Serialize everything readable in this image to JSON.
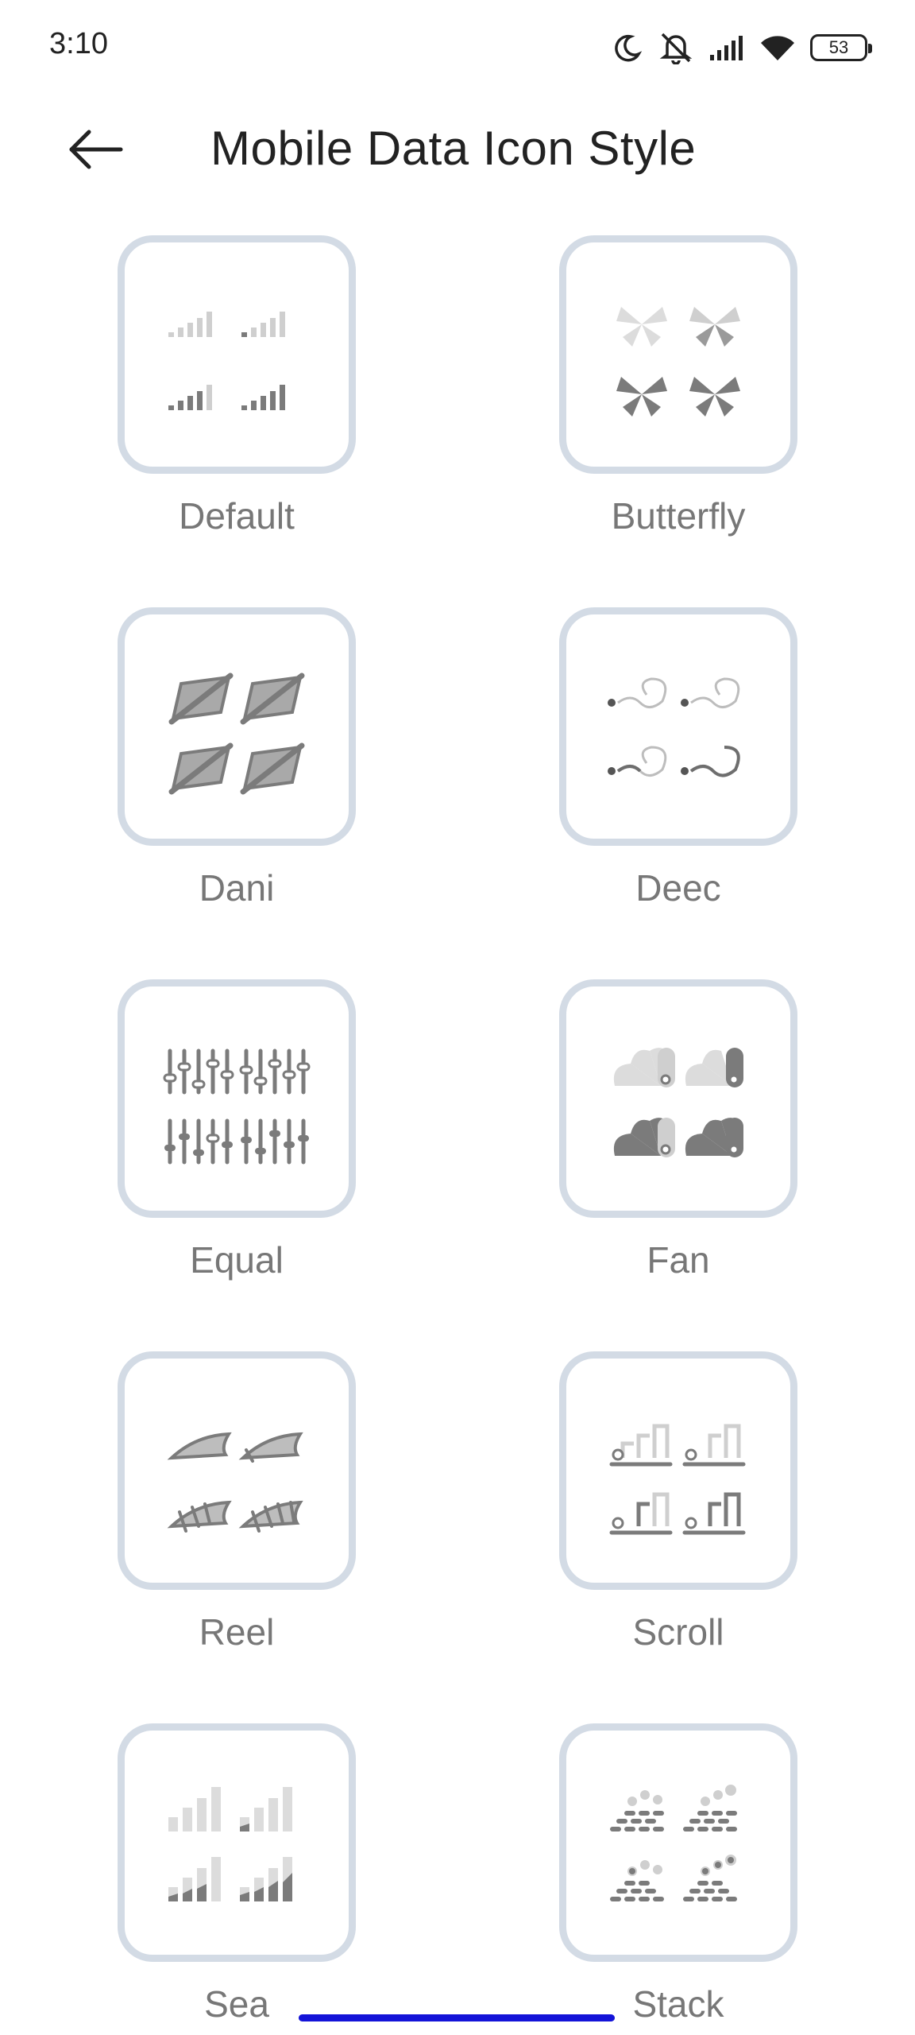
{
  "status_bar": {
    "time": "3:10",
    "icons": [
      "moon-icon",
      "bell-muted-icon",
      "cellular-signal-icon",
      "wifi-icon",
      "battery-icon"
    ],
    "battery_level": "53"
  },
  "header": {
    "back_icon": "arrow-left-icon",
    "title": "Mobile Data Icon Style"
  },
  "styles": [
    {
      "label": "Default"
    },
    {
      "label": "Butterfly"
    },
    {
      "label": "Dani"
    },
    {
      "label": "Deec"
    },
    {
      "label": "Equal"
    },
    {
      "label": "Fan"
    },
    {
      "label": "Reel"
    },
    {
      "label": "Scroll"
    },
    {
      "label": "Sea"
    },
    {
      "label": "Stack"
    }
  ],
  "colors": {
    "tile_border": "#d3dbe5",
    "icon_light": "#cfcfcf",
    "icon_dark": "#7b7b7b",
    "label": "#777777",
    "gesture_bar": "#1414d8"
  }
}
